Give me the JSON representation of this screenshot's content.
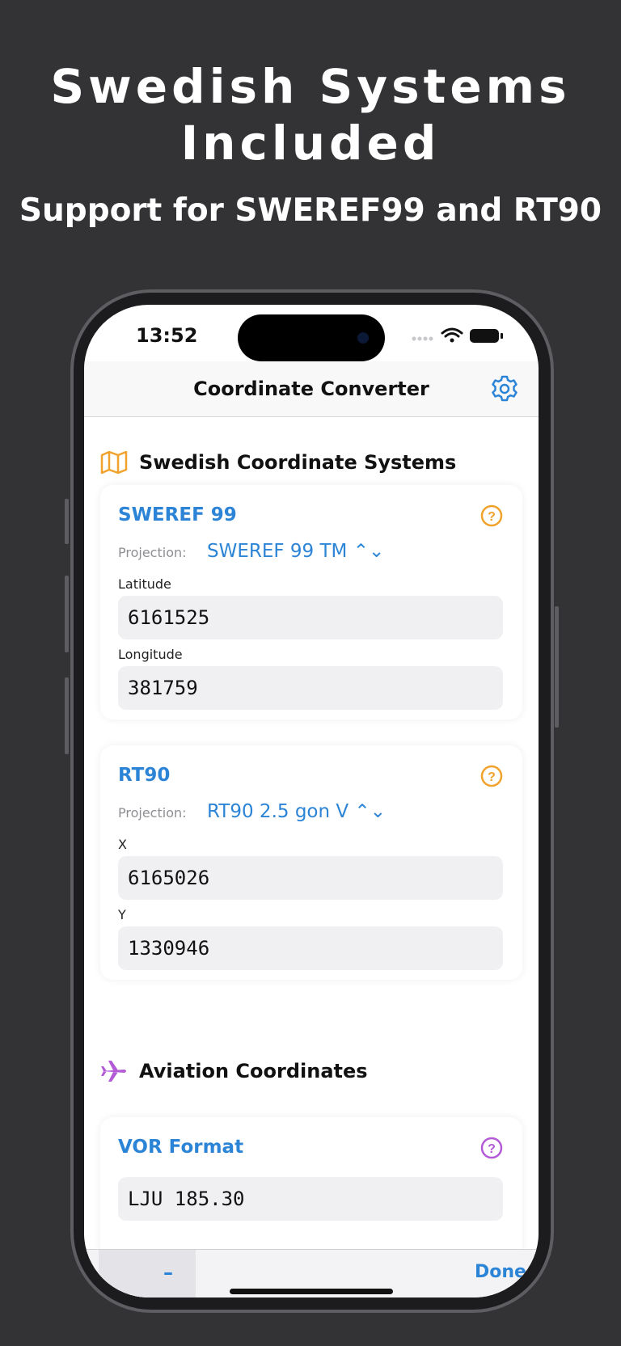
{
  "promo": {
    "headline": "Swedish Systems Included",
    "subline": "Support for SWEREF99 and RT90"
  },
  "status_bar": {
    "time": "13:52"
  },
  "nav": {
    "title": "Coordinate Converter",
    "settings_icon": "gear-icon"
  },
  "swedish": {
    "section_title": "Swedish Coordinate Systems",
    "sweref": {
      "title": "SWEREF 99",
      "projection_label": "Projection:",
      "projection_value": "SWEREF 99 TM ⌃⌄",
      "lat_label": "Latitude",
      "lat_value": "6161525",
      "lon_label": "Longitude",
      "lon_value": "381759"
    },
    "rt90": {
      "title": "RT90",
      "projection_label": "Projection:",
      "projection_value": "RT90 2.5 gon V ⌃⌄",
      "x_label": "X",
      "x_value": "6165026",
      "y_label": "Y",
      "y_value": "1330946"
    }
  },
  "aviation": {
    "section_title": "Aviation Coordinates",
    "vor_title": "VOR Format",
    "vor_value": "LJU 185.30"
  },
  "keyboard_toolbar": {
    "minus": "–",
    "done": "Done"
  },
  "colors": {
    "accent": "#2c84d6",
    "map_icon": "#f0a22c",
    "plane_icon": "#b35ad6",
    "background": "#333335"
  }
}
